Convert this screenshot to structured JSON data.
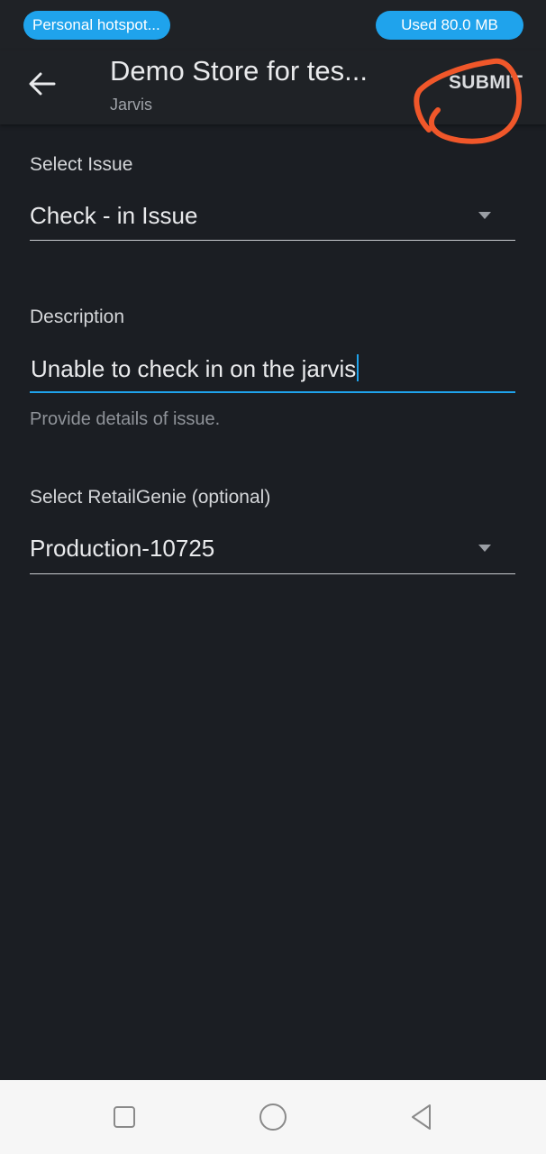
{
  "status_bar": {
    "hotspot_label": "Personal hotspot...",
    "data_usage_label": "Used  80.0 MB"
  },
  "app_bar": {
    "title": "Demo Store for tes...",
    "subtitle": "Jarvis",
    "submit_label": "SUBMIT",
    "back_icon": "arrow-left-icon"
  },
  "form": {
    "issue": {
      "label": "Select Issue",
      "value": "Check - in Issue"
    },
    "description": {
      "label": "Description",
      "value": "Unable to check in on the jarvis",
      "helper": "Provide details of issue."
    },
    "retail_genie": {
      "label": "Select RetailGenie (optional)",
      "value": "Production-10725"
    }
  },
  "nav_bar": {
    "icons": [
      "recent-apps-icon",
      "home-icon",
      "back-triangle-icon"
    ]
  },
  "colors": {
    "background": "#1b1e23",
    "accent": "#1fa3ec",
    "annotation": "#f0572a"
  }
}
